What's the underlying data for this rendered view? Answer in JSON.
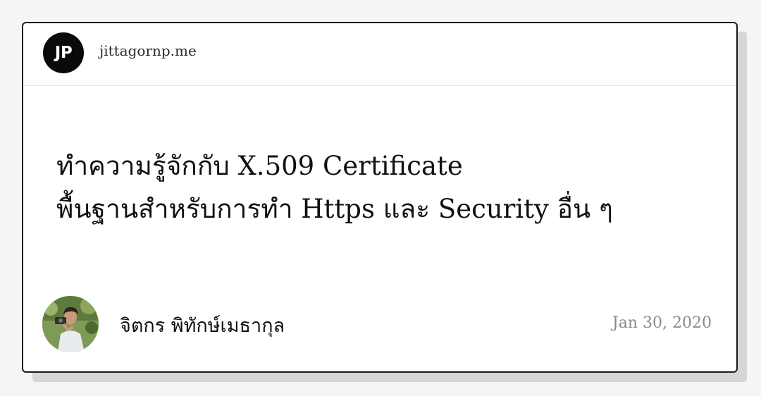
{
  "site": {
    "logo_text": "JP",
    "domain": "jittagornp.me"
  },
  "article": {
    "title_line1": "ทำความรู้จักกับ X.509 Certificate",
    "title_line2": "พื้นฐานสำหรับการทำ Https และ Security อื่น ๆ"
  },
  "author": {
    "name": "จิตกร พิทักษ์เมธากุล"
  },
  "meta": {
    "date": "Jan 30, 2020"
  },
  "colors": {
    "card_border": "#1a1a1a",
    "logo_bg": "#0a0a0a",
    "date_text": "#8a8a8a",
    "shadow": "#d6d6d6"
  }
}
